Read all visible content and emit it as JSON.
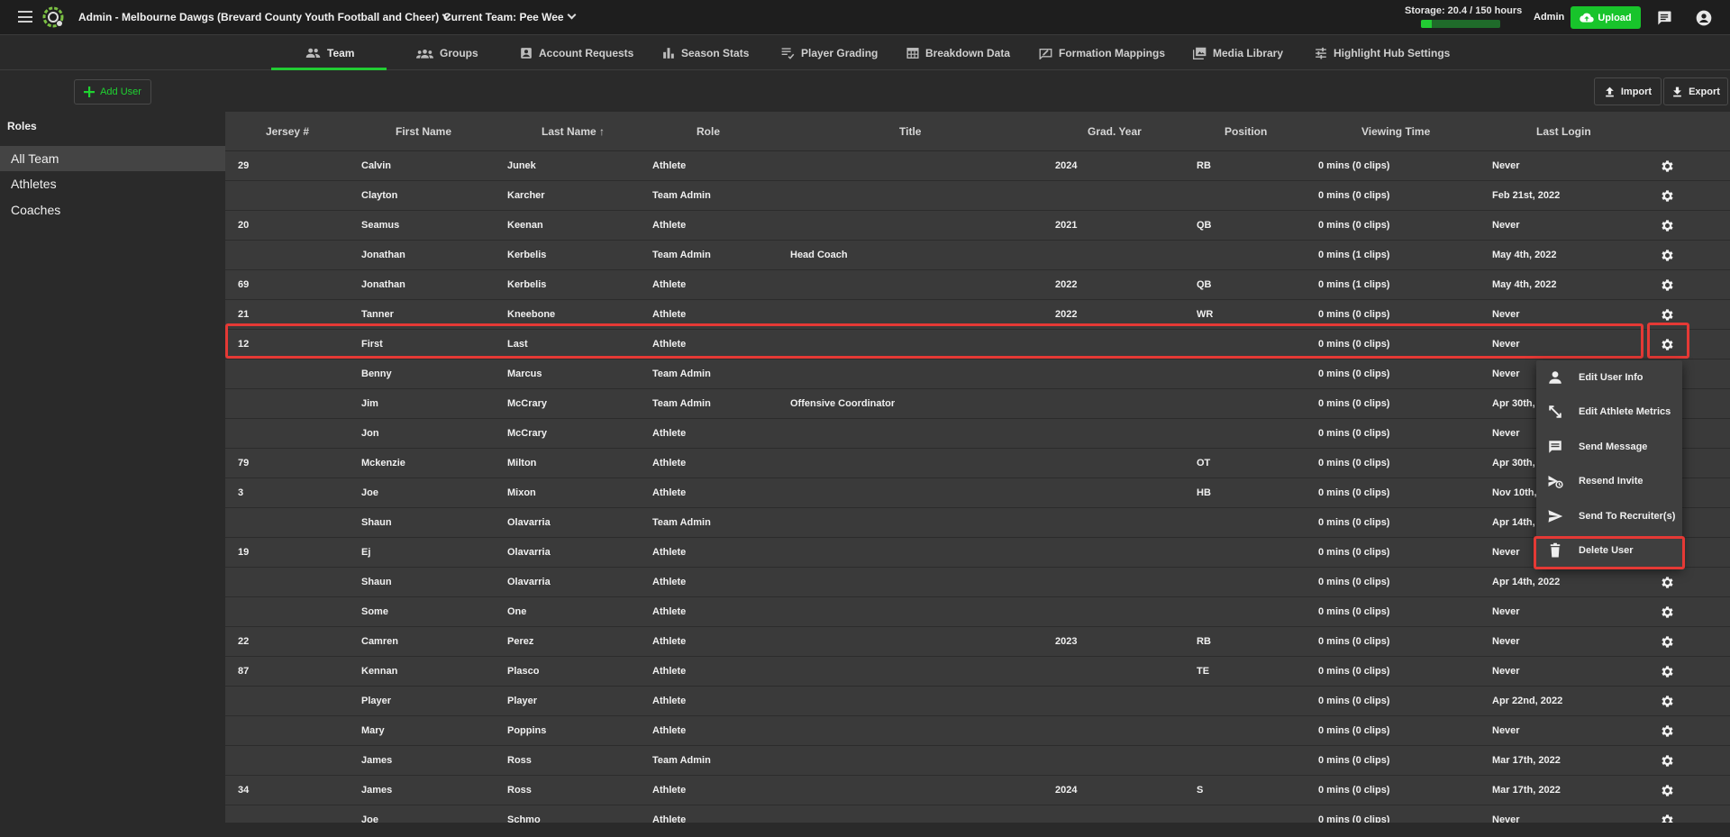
{
  "topbar": {
    "org_label": "Admin - Melbourne Dawgs (Brevard County Youth Football and Cheer)",
    "team_label": "Current Team: Pee Wee",
    "storage_label": "Storage: 20.4 / 150 hours",
    "storage_fraction": 0.136,
    "admin_label": "Admin",
    "upload_label": "Upload"
  },
  "nav": {
    "tabs": [
      {
        "label": "Team",
        "icon": "people-icon",
        "active": true
      },
      {
        "label": "Groups",
        "icon": "groups-icon"
      },
      {
        "label": "Account Requests",
        "icon": "account-box-icon"
      },
      {
        "label": "Season Stats",
        "icon": "bar-chart-icon"
      },
      {
        "label": "Player Grading",
        "icon": "list-check-icon"
      },
      {
        "label": "Breakdown Data",
        "icon": "table-icon"
      },
      {
        "label": "Formation Mappings",
        "icon": "draw-icon"
      },
      {
        "label": "Media Library",
        "icon": "photo-library-icon"
      },
      {
        "label": "Highlight Hub Settings",
        "icon": "tune-icon"
      }
    ]
  },
  "actions": {
    "add_user_label": "Add User",
    "import_label": "Import",
    "export_label": "Export"
  },
  "sidebar": {
    "title": "Roles",
    "items": [
      {
        "label": "All Team",
        "active": true
      },
      {
        "label": "Athletes"
      },
      {
        "label": "Coaches"
      }
    ]
  },
  "table": {
    "headers": [
      "Jersey #",
      "First Name",
      "Last Name",
      "Role",
      "Title",
      "Grad. Year",
      "Position",
      "Viewing Time",
      "Last Login"
    ],
    "sort_indicator": "↑",
    "rows": [
      {
        "jersey": "29",
        "first": "Calvin",
        "last": "Junek",
        "role": "Athlete",
        "title": "",
        "grad": "2024",
        "position": "RB",
        "viewing": "0 mins (0 clips)",
        "login": "Never"
      },
      {
        "jersey": "",
        "first": "Clayton",
        "last": "Karcher",
        "role": "Team Admin",
        "title": "",
        "grad": "",
        "position": "",
        "viewing": "0 mins (0 clips)",
        "login": "Feb 21st, 2022"
      },
      {
        "jersey": "20",
        "first": "Seamus",
        "last": "Keenan",
        "role": "Athlete",
        "title": "",
        "grad": "2021",
        "position": "QB",
        "viewing": "0 mins (0 clips)",
        "login": "Never"
      },
      {
        "jersey": "",
        "first": "Jonathan",
        "last": "Kerbelis",
        "role": "Team Admin",
        "title": "Head Coach",
        "grad": "",
        "position": "",
        "viewing": "0 mins (1 clips)",
        "login": "May 4th, 2022"
      },
      {
        "jersey": "69",
        "first": "Jonathan",
        "last": "Kerbelis",
        "role": "Athlete",
        "title": "",
        "grad": "2022",
        "position": "QB",
        "viewing": "0 mins (1 clips)",
        "login": "May 4th, 2022"
      },
      {
        "jersey": "21",
        "first": "Tanner",
        "last": "Kneebone",
        "role": "Athlete",
        "title": "",
        "grad": "2022",
        "position": "WR",
        "viewing": "0 mins (0 clips)",
        "login": "Never"
      },
      {
        "jersey": "12",
        "first": "First",
        "last": "Last",
        "role": "Athlete",
        "title": "",
        "grad": "",
        "position": "",
        "viewing": "0 mins (0 clips)",
        "login": "Never"
      },
      {
        "jersey": "",
        "first": "Benny",
        "last": "Marcus",
        "role": "Team Admin",
        "title": "",
        "grad": "",
        "position": "",
        "viewing": "0 mins (0 clips)",
        "login": "Never"
      },
      {
        "jersey": "",
        "first": "Jim",
        "last": "McCrary",
        "role": "Team Admin",
        "title": "Offensive Coordinator",
        "grad": "",
        "position": "",
        "viewing": "0 mins (0 clips)",
        "login": "Apr 30th,"
      },
      {
        "jersey": "",
        "first": "Jon",
        "last": "McCrary",
        "role": "Athlete",
        "title": "",
        "grad": "",
        "position": "",
        "viewing": "0 mins (0 clips)",
        "login": "Never"
      },
      {
        "jersey": "79",
        "first": "Mckenzie",
        "last": "Milton",
        "role": "Athlete",
        "title": "",
        "grad": "",
        "position": "OT",
        "viewing": "0 mins (0 clips)",
        "login": "Apr 30th,"
      },
      {
        "jersey": "3",
        "first": "Joe",
        "last": "Mixon",
        "role": "Athlete",
        "title": "",
        "grad": "",
        "position": "HB",
        "viewing": "0 mins (0 clips)",
        "login": "Nov 10th,"
      },
      {
        "jersey": "",
        "first": "Shaun",
        "last": "Olavarria",
        "role": "Team Admin",
        "title": "",
        "grad": "",
        "position": "",
        "viewing": "0 mins (0 clips)",
        "login": "Apr 14th,"
      },
      {
        "jersey": "19",
        "first": "Ej",
        "last": "Olavarria",
        "role": "Athlete",
        "title": "",
        "grad": "",
        "position": "",
        "viewing": "0 mins (0 clips)",
        "login": "Never"
      },
      {
        "jersey": "",
        "first": "Shaun",
        "last": "Olavarria",
        "role": "Athlete",
        "title": "",
        "grad": "",
        "position": "",
        "viewing": "0 mins (0 clips)",
        "login": "Apr 14th, 2022"
      },
      {
        "jersey": "",
        "first": "Some",
        "last": "One",
        "role": "Athlete",
        "title": "",
        "grad": "",
        "position": "",
        "viewing": "0 mins (0 clips)",
        "login": "Never"
      },
      {
        "jersey": "22",
        "first": "Camren",
        "last": "Perez",
        "role": "Athlete",
        "title": "",
        "grad": "2023",
        "position": "RB",
        "viewing": "0 mins (0 clips)",
        "login": "Never"
      },
      {
        "jersey": "87",
        "first": "Kennan",
        "last": "Plasco",
        "role": "Athlete",
        "title": "",
        "grad": "",
        "position": "TE",
        "viewing": "0 mins (0 clips)",
        "login": "Never"
      },
      {
        "jersey": "",
        "first": "Player",
        "last": "Player",
        "role": "Athlete",
        "title": "",
        "grad": "",
        "position": "",
        "viewing": "0 mins (0 clips)",
        "login": "Apr 22nd, 2022"
      },
      {
        "jersey": "",
        "first": "Mary",
        "last": "Poppins",
        "role": "Athlete",
        "title": "",
        "grad": "",
        "position": "",
        "viewing": "0 mins (0 clips)",
        "login": "Never"
      },
      {
        "jersey": "",
        "first": "James",
        "last": "Ross",
        "role": "Team Admin",
        "title": "",
        "grad": "",
        "position": "",
        "viewing": "0 mins (0 clips)",
        "login": "Mar 17th, 2022"
      },
      {
        "jersey": "34",
        "first": "James",
        "last": "Ross",
        "role": "Athlete",
        "title": "",
        "grad": "2024",
        "position": "S",
        "viewing": "0 mins (0 clips)",
        "login": "Mar 17th, 2022"
      },
      {
        "jersey": "",
        "first": "Joe",
        "last": "Schmo",
        "role": "Athlete",
        "title": "",
        "grad": "",
        "position": "",
        "viewing": "0 mins (0 clips)",
        "login": "Never"
      }
    ]
  },
  "menu": {
    "items": [
      {
        "label": "Edit User Info",
        "icon": "person-icon"
      },
      {
        "label": "Edit Athlete Metrics",
        "icon": "expand-arrows-icon"
      },
      {
        "label": "Send Message",
        "icon": "message-icon"
      },
      {
        "label": "Resend Invite",
        "icon": "resend-icon"
      },
      {
        "label": "Send To Recruiter(s)",
        "icon": "send-icon"
      },
      {
        "label": "Delete User",
        "icon": "trash-icon"
      }
    ]
  },
  "colors": {
    "accent": "#22cc33",
    "highlight": "#e53935",
    "table_bg": "#3a3a3a",
    "page_bg": "#2a2a2a"
  }
}
